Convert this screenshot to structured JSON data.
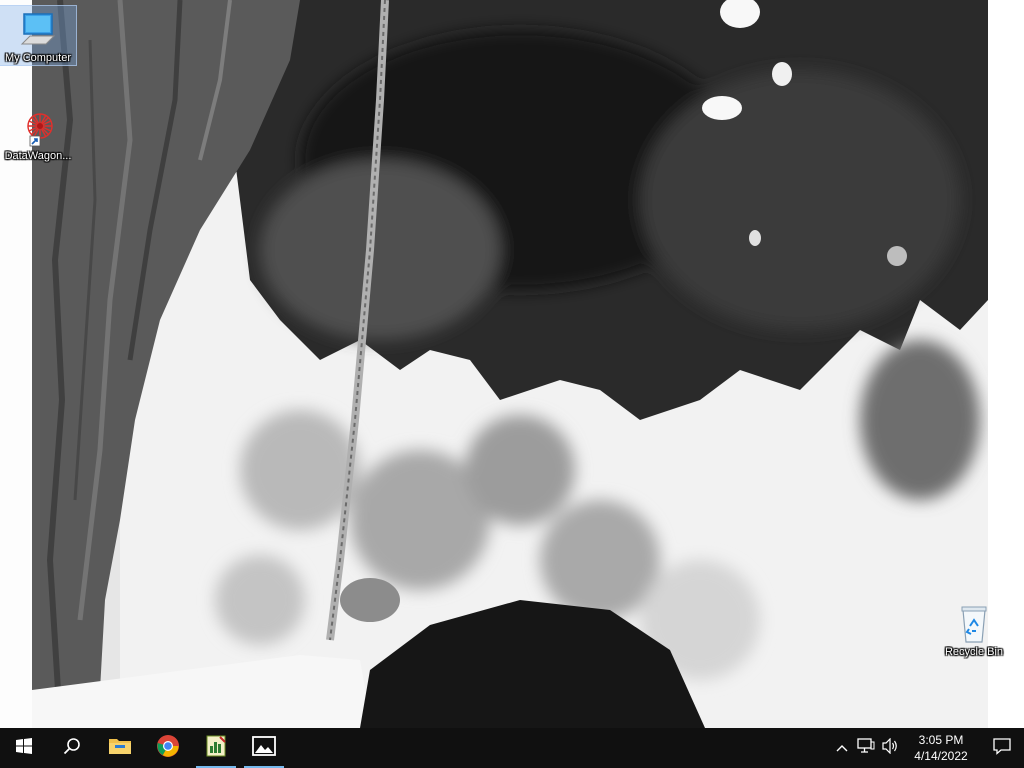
{
  "desktop": {
    "icons": [
      {
        "label": "My Computer",
        "icon": "monitor-icon"
      },
      {
        "label": "DataWagon...",
        "icon": "datawagon-icon"
      },
      {
        "label": "Recycle Bin",
        "icon": "recycle-bin-icon"
      }
    ],
    "wallpaper": "black-and-white photo of a tree trunk, rope and leaves"
  },
  "taskbar": {
    "start": "windows-start-icon",
    "search": "search-icon",
    "pinned": [
      {
        "name": "file-explorer",
        "icon": "folder-icon"
      },
      {
        "name": "chrome",
        "icon": "chrome-icon"
      },
      {
        "name": "notepad-app",
        "icon": "chart-notepad-icon"
      },
      {
        "name": "photos",
        "icon": "photos-icon"
      }
    ],
    "tray": {
      "icons": [
        "chevron-up-icon",
        "network-icon",
        "volume-icon"
      ],
      "time": "3:05 PM",
      "date": "4/14/2022"
    },
    "colors": {
      "background": "#101010",
      "accent": "#76b9ed"
    }
  }
}
